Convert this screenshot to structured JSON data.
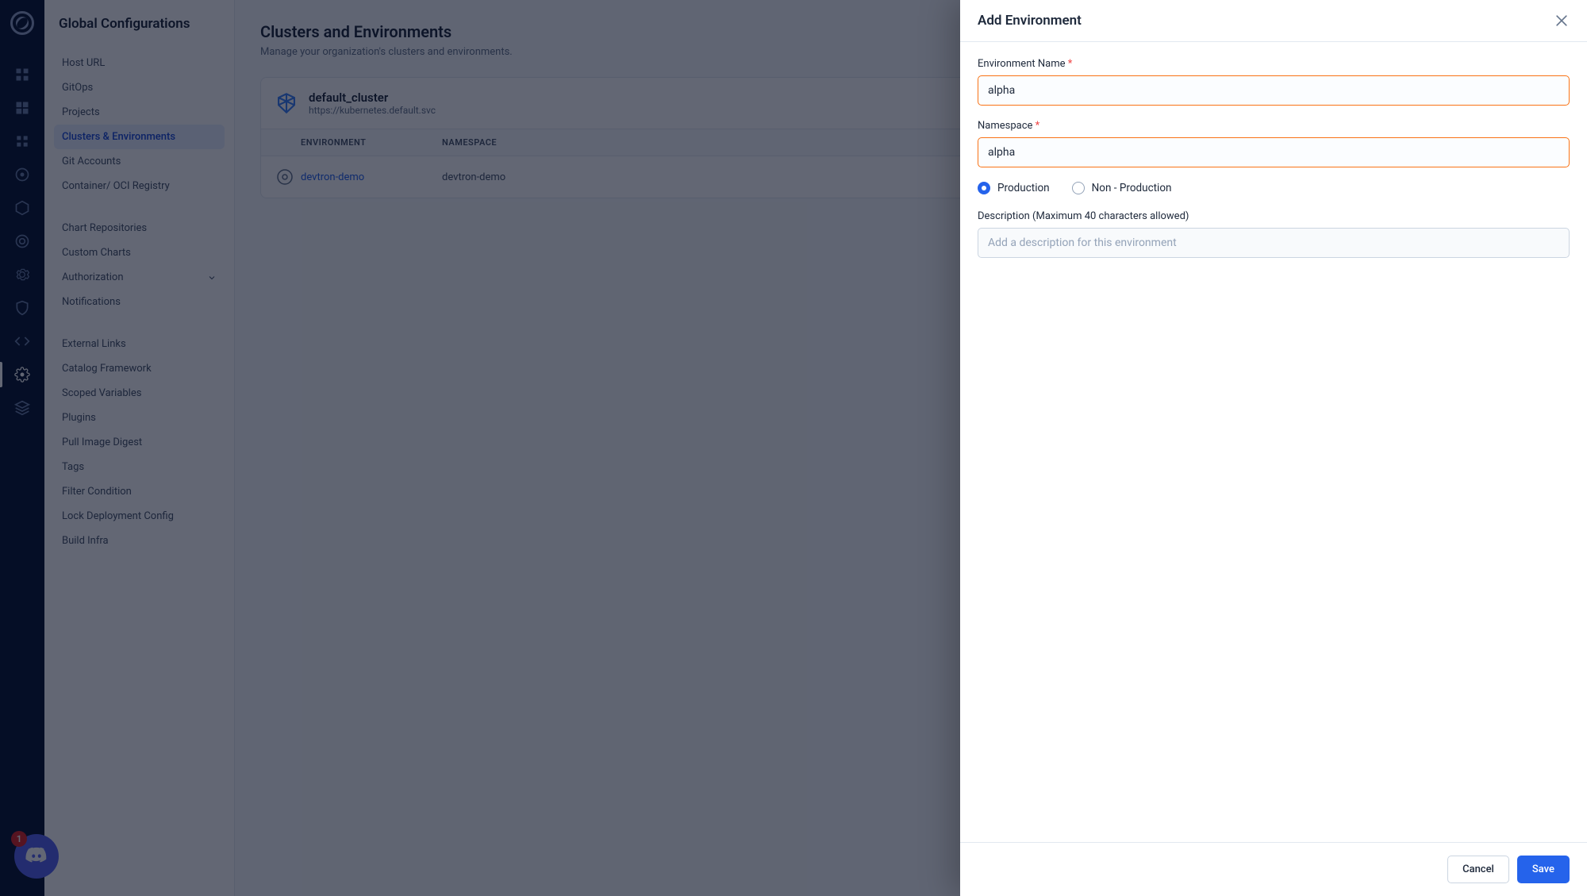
{
  "sidebar": {
    "title": "Global Configurations",
    "groups": [
      [
        "Host URL",
        "GitOps",
        "Projects",
        "Clusters & Environments",
        "Git Accounts",
        "Container/ OCI Registry"
      ],
      [
        "Chart Repositories",
        "Custom Charts",
        "Authorization",
        "Notifications"
      ],
      [
        "External Links",
        "Catalog Framework",
        "Scoped Variables",
        "Plugins",
        "Pull Image Digest",
        "Tags",
        "Filter Condition",
        "Lock Deployment Config",
        "Build Infra"
      ]
    ],
    "active": "Clusters & Environments",
    "expandable": [
      "Authorization"
    ]
  },
  "main": {
    "heading": "Clusters and Environments",
    "subtitle": "Manage your organization's clusters and environments.",
    "cluster": {
      "name": "default_cluster",
      "url": "https://kubernetes.default.svc",
      "columns": [
        "ENVIRONMENT",
        "NAMESPACE"
      ],
      "rows": [
        {
          "env": "devtron-demo",
          "ns": "devtron-demo"
        }
      ]
    }
  },
  "drawer": {
    "title": "Add Environment",
    "fields": {
      "envName": {
        "label": "Environment Name",
        "required": true,
        "value": "alpha"
      },
      "namespace": {
        "label": "Namespace",
        "required": true,
        "value": "alpha"
      },
      "description": {
        "label": "Description (Maximum 40 characters allowed)",
        "placeholder": "Add a description for this environment",
        "value": ""
      }
    },
    "radios": {
      "production": "Production",
      "nonProduction": "Non - Production",
      "selected": "production"
    },
    "buttons": {
      "cancel": "Cancel",
      "save": "Save"
    }
  },
  "discord": {
    "badge": "1"
  }
}
